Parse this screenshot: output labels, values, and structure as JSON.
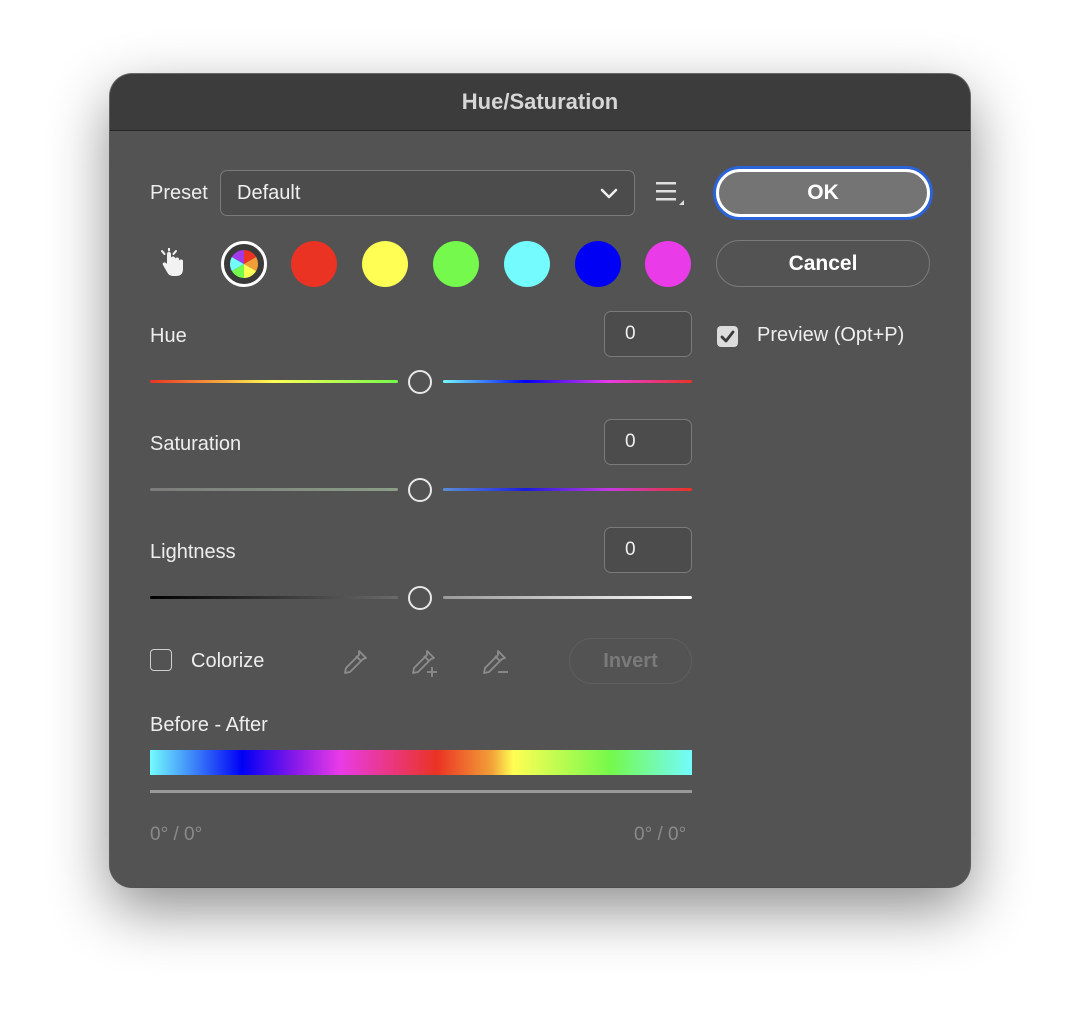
{
  "dialog": {
    "title": "Hue/Saturation",
    "preset_label": "Preset",
    "preset_value": "Default",
    "ok_label": "OK",
    "cancel_label": "Cancel",
    "preview_label": "Preview (Opt+P)",
    "preview_checked": true
  },
  "channels": [
    {
      "name": "master",
      "color": "#ffffff"
    },
    {
      "name": "reds",
      "color": "#ea3323"
    },
    {
      "name": "yellows",
      "color": "#fffe54"
    },
    {
      "name": "greens",
      "color": "#74f94c"
    },
    {
      "name": "cyans",
      "color": "#73fbfd"
    },
    {
      "name": "blues",
      "color": "#0000f5"
    },
    {
      "name": "magentas",
      "color": "#e93be7"
    }
  ],
  "sliders": {
    "hue": {
      "label": "Hue",
      "value": "0",
      "position": 0.5
    },
    "saturation": {
      "label": "Saturation",
      "value": "0",
      "position": 0.5
    },
    "lightness": {
      "label": "Lightness",
      "value": "0",
      "position": 0.5
    }
  },
  "colorize": {
    "label": "Colorize",
    "checked": false
  },
  "invert_label": "Invert",
  "before_after": {
    "label": "Before - After",
    "left_readout": "0° / 0°",
    "right_readout": "0° / 0°"
  },
  "icons": {
    "targeted_adjustment": "hand-pointer-icon",
    "preset_menu": "list-menu-icon",
    "eyedropper": "eyedropper-icon",
    "eyedropper_add": "eyedropper-plus-icon",
    "eyedropper_subtract": "eyedropper-minus-icon"
  },
  "colors": {
    "dialog_bg": "#535353",
    "titlebar_bg": "#3c3c3c",
    "focus_ring": "#2b63d9"
  }
}
